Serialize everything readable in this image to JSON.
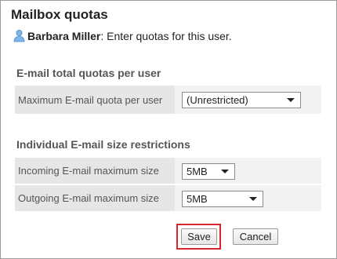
{
  "page": {
    "title": "Mailbox quotas",
    "user_name": "Barbara Miller",
    "user_instruction": ": Enter quotas for this user."
  },
  "sections": {
    "total": {
      "title": "E-mail total quotas per user",
      "max_quota_label": "Maximum E-mail quota per user",
      "max_quota_value": "(Unrestricted)"
    },
    "individual": {
      "title": "Individual E-mail size restrictions",
      "incoming_label": "Incoming E-mail maximum size",
      "incoming_value": "5MB",
      "outgoing_label": "Outgoing E-mail maximum size",
      "outgoing_value": "5MB"
    }
  },
  "actions": {
    "save_label": "Save",
    "cancel_label": "Cancel"
  },
  "icons": {
    "user": "user-icon",
    "dropdown": "chevron-down-icon"
  },
  "colors": {
    "highlight": "#d8262e",
    "user_icon": "#6aa8e0"
  }
}
